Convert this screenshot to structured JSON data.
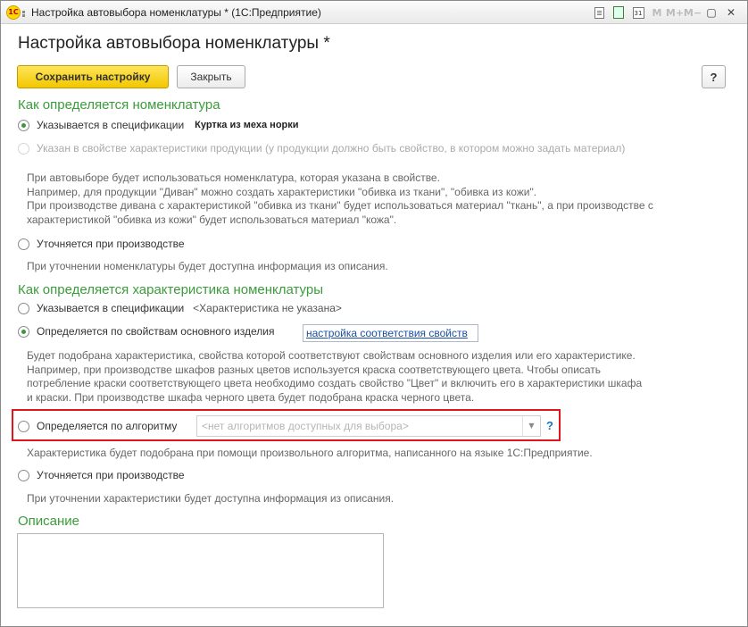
{
  "window": {
    "title": "Настройка автовыбора номенклатуры * (1С:Предприятие)",
    "logo_text": "1С",
    "toolbar": {
      "m": "M",
      "m_plus": "M+",
      "m_minus": "M−",
      "minimize": "▢",
      "close": "✕",
      "calendar_day": "31"
    }
  },
  "page": {
    "title": "Настройка автовыбора номенклатуры *"
  },
  "commands": {
    "save_label": "Сохранить настройку",
    "close_label": "Закрыть",
    "help_label": "?"
  },
  "nomenclature": {
    "title": "Как определяется номенклатура",
    "option_spec": {
      "label": "Указывается в спецификации",
      "value": "Куртка из меха норки",
      "selected": true
    },
    "option_property": {
      "label": "Указан в свойстве характеристики продукции (у продукции должно быть свойство, в котором можно задать материал)",
      "disabled": true
    },
    "property_hint": [
      "При автовыборе будет использоваться номенклатура, которая указана в свойстве.",
      "Например, для продукции \"Диван\" можно создать характеристики \"обивка из ткани\", \"обивка из кожи\".",
      "При производстве дивана с характеристикой \"обивка из ткани\" будет использоваться материал \"ткань\", а при производстве с",
      "характеристикой \"обивка из кожи\" будет использоваться материал \"кожа\"."
    ],
    "option_production": {
      "label": "Уточняется при производстве"
    },
    "production_hint": "При уточнении номенклатуры будет доступна информация из описания."
  },
  "characteristic": {
    "title": "Как определяется характеристика номенклатуры",
    "option_spec": {
      "label": "Указывается в спецификации",
      "value": "<Характеристика не указана>"
    },
    "option_properties": {
      "label": "Определяется по свойствам основного изделия",
      "link": "настройка соответствия свойств",
      "selected": true
    },
    "properties_hint": [
      "Будет подобрана характеристика, свойства которой соответствуют свойствам основного изделия или его характеристике.",
      "Например, при производстве шкафов разных цветов используется краска соответствующего цвета. Чтобы описать",
      "потребление краски соответствующего цвета необходимо создать свойство \"Цвет\" и включить его в характеристики шкафа",
      "и краски. При производстве шкафа черного цвета будет подобрана краска черного цвета."
    ],
    "option_algorithm": {
      "label": "Определяется по алгоритму",
      "placeholder": "<нет алгоритмов доступных для выбора>",
      "help": "?"
    },
    "algorithm_hint": "Характеристика будет подобрана при помощи произвольного алгоритма, написанного на языке 1С:Предприятие.",
    "option_production": {
      "label": "Уточняется при производстве"
    },
    "production_hint": "При уточнении характеристики будет доступна информация из описания."
  },
  "description": {
    "title": "Описание",
    "value": ""
  },
  "colors": {
    "accent_green": "#3b9c3b",
    "save_yellow": "#f2c700",
    "highlight_red": "#e0161a",
    "link_blue": "#1a4fa0"
  }
}
